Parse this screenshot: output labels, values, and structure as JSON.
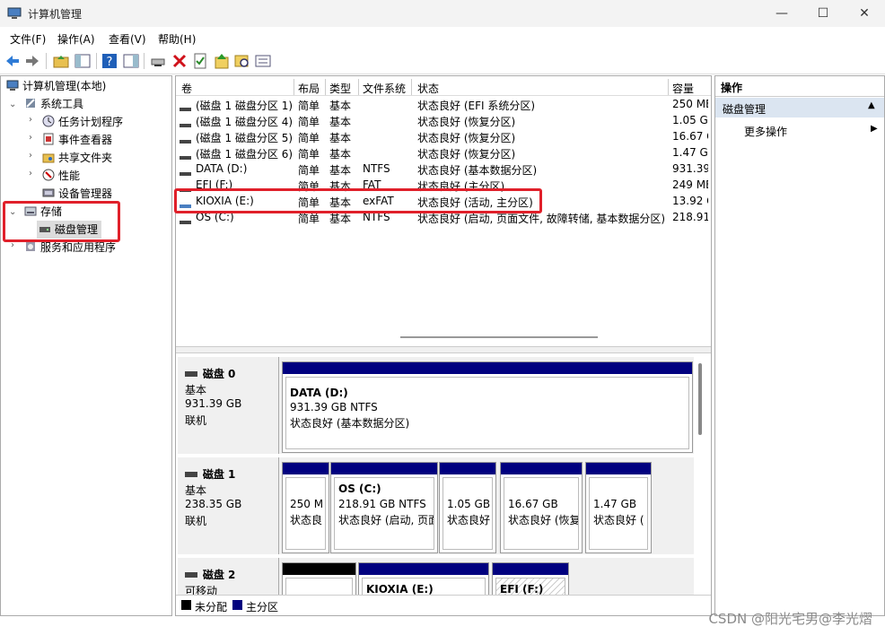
{
  "window": {
    "title": "计算机管理",
    "min": "—",
    "max": "☐",
    "close": "✕"
  },
  "menu": [
    "文件(F)",
    "操作(A)",
    "查看(V)",
    "帮助(H)"
  ],
  "tree": {
    "root": "计算机管理(本地)",
    "system_tools": "系统工具",
    "task_scheduler": "任务计划程序",
    "event_viewer": "事件查看器",
    "shared_folders": "共享文件夹",
    "performance": "性能",
    "device_manager": "设备管理器",
    "storage": "存储",
    "disk_management": "磁盘管理",
    "services": "服务和应用程序"
  },
  "volumes": {
    "headers": [
      "卷",
      "布局",
      "类型",
      "文件系统",
      "状态",
      "容量"
    ],
    "rows": [
      [
        "(磁盘 1 磁盘分区 1)",
        "简单",
        "基本",
        "",
        "状态良好 (EFI 系统分区)",
        "250 ME"
      ],
      [
        "(磁盘 1 磁盘分区 4)",
        "简单",
        "基本",
        "",
        "状态良好 (恢复分区)",
        "1.05 GE"
      ],
      [
        "(磁盘 1 磁盘分区 5)",
        "简单",
        "基本",
        "",
        "状态良好 (恢复分区)",
        "16.67 G"
      ],
      [
        "(磁盘 1 磁盘分区 6)",
        "简单",
        "基本",
        "",
        "状态良好 (恢复分区)",
        "1.47 GE"
      ],
      [
        "DATA (D:)",
        "简单",
        "基本",
        "NTFS",
        "状态良好 (基本数据分区)",
        "931.39"
      ],
      [
        "EFI (F:)",
        "简单",
        "基本",
        "FAT",
        "状态良好 (主分区)",
        "249 ME"
      ],
      [
        "KIOXIA (E:)",
        "简单",
        "基本",
        "exFAT",
        "状态良好 (活动, 主分区)",
        "13.92 G"
      ],
      [
        "OS (C:)",
        "简单",
        "基本",
        "NTFS",
        "状态良好 (启动, 页面文件, 故障转储, 基本数据分区)",
        "218.91"
      ]
    ]
  },
  "disks": {
    "d0": {
      "name": "磁盘 0",
      "type": "基本",
      "size": "931.39 GB",
      "status": "联机",
      "p1": {
        "title": "DATA  (D:)",
        "size": "931.39 GB NTFS",
        "status": "状态良好 (基本数据分区)"
      }
    },
    "d1": {
      "name": "磁盘 1",
      "type": "基本",
      "size": "238.35 GB",
      "status": "联机",
      "p1": {
        "size": "250 M",
        "status": "状态良"
      },
      "p2": {
        "title": "OS  (C:)",
        "size": "218.91 GB NTFS",
        "status": "状态良好 (启动, 页面"
      },
      "p3": {
        "size": "1.05 GB",
        "status": "状态良好"
      },
      "p4": {
        "size": "16.67 GB",
        "status": "状态良好 (恢复"
      },
      "p5": {
        "size": "1.47 GB",
        "status": "状态良好 ("
      }
    },
    "d2": {
      "name": "磁盘 2",
      "type": "可移动",
      "p2": {
        "title": "KIOXIA  (E:)"
      },
      "p3": {
        "title": "EFI  (F:)"
      }
    }
  },
  "legend": {
    "unallocated": "未分配",
    "primary": "主分区"
  },
  "actions": {
    "header": "操作",
    "selected": "磁盘管理",
    "more": "更多操作"
  },
  "watermark": "CSDN @阳光宅男@李光熠",
  "colors": {
    "primary_partition": "#00007f",
    "unallocated": "#000000",
    "highlight": "#e0202a"
  }
}
